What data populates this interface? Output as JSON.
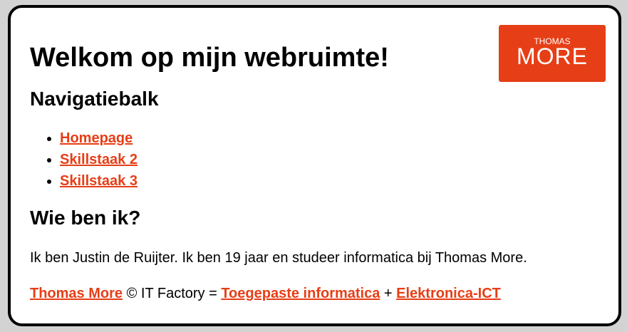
{
  "logo": {
    "top_text": "THOMAS",
    "main_text": "MORE"
  },
  "title": "Welkom op mijn webruimte!",
  "nav": {
    "heading": "Navigatiebalk",
    "links": [
      "Homepage",
      "Skillstaak 2",
      "Skillstaak 3"
    ]
  },
  "about": {
    "heading": "Wie ben ik?",
    "text": "Ik ben Justin de Ruijter. Ik ben 19 jaar en studeer informatica bij Thomas More."
  },
  "footer": {
    "link1": "Thomas More",
    "text1": " © IT Factory = ",
    "link2": "Toegepaste informatica",
    "text2": " + ",
    "link3": "Elektronica-ICT"
  },
  "colors": {
    "accent": "#e63e16",
    "page_bg": "#d3d3d3",
    "card_bg": "#ffffff",
    "border": "#000000"
  }
}
